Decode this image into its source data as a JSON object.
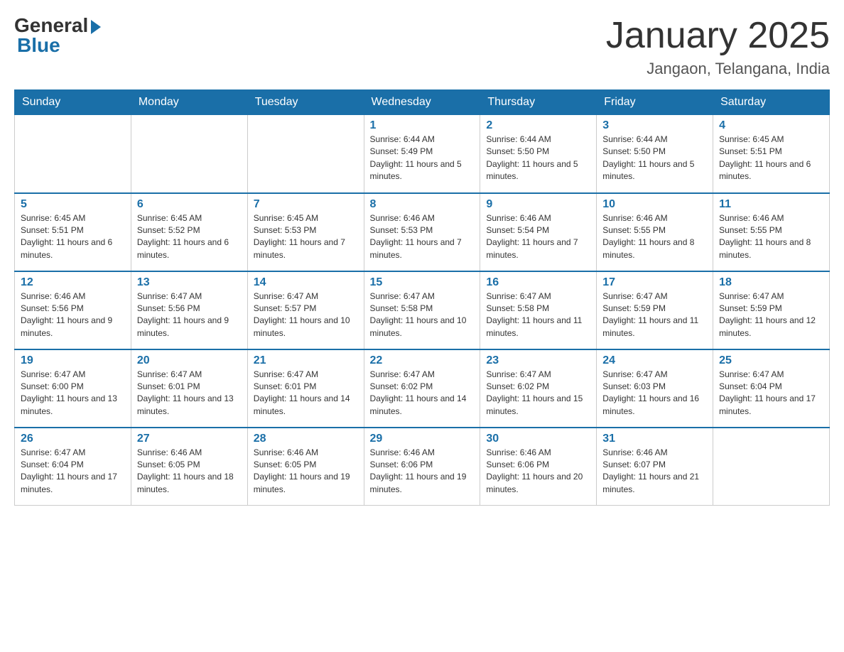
{
  "logo": {
    "general": "General",
    "blue": "Blue"
  },
  "title": "January 2025",
  "location": "Jangaon, Telangana, India",
  "days_of_week": [
    "Sunday",
    "Monday",
    "Tuesday",
    "Wednesday",
    "Thursday",
    "Friday",
    "Saturday"
  ],
  "weeks": [
    [
      {
        "day": "",
        "info": ""
      },
      {
        "day": "",
        "info": ""
      },
      {
        "day": "",
        "info": ""
      },
      {
        "day": "1",
        "info": "Sunrise: 6:44 AM\nSunset: 5:49 PM\nDaylight: 11 hours and 5 minutes."
      },
      {
        "day": "2",
        "info": "Sunrise: 6:44 AM\nSunset: 5:50 PM\nDaylight: 11 hours and 5 minutes."
      },
      {
        "day": "3",
        "info": "Sunrise: 6:44 AM\nSunset: 5:50 PM\nDaylight: 11 hours and 5 minutes."
      },
      {
        "day": "4",
        "info": "Sunrise: 6:45 AM\nSunset: 5:51 PM\nDaylight: 11 hours and 6 minutes."
      }
    ],
    [
      {
        "day": "5",
        "info": "Sunrise: 6:45 AM\nSunset: 5:51 PM\nDaylight: 11 hours and 6 minutes."
      },
      {
        "day": "6",
        "info": "Sunrise: 6:45 AM\nSunset: 5:52 PM\nDaylight: 11 hours and 6 minutes."
      },
      {
        "day": "7",
        "info": "Sunrise: 6:45 AM\nSunset: 5:53 PM\nDaylight: 11 hours and 7 minutes."
      },
      {
        "day": "8",
        "info": "Sunrise: 6:46 AM\nSunset: 5:53 PM\nDaylight: 11 hours and 7 minutes."
      },
      {
        "day": "9",
        "info": "Sunrise: 6:46 AM\nSunset: 5:54 PM\nDaylight: 11 hours and 7 minutes."
      },
      {
        "day": "10",
        "info": "Sunrise: 6:46 AM\nSunset: 5:55 PM\nDaylight: 11 hours and 8 minutes."
      },
      {
        "day": "11",
        "info": "Sunrise: 6:46 AM\nSunset: 5:55 PM\nDaylight: 11 hours and 8 minutes."
      }
    ],
    [
      {
        "day": "12",
        "info": "Sunrise: 6:46 AM\nSunset: 5:56 PM\nDaylight: 11 hours and 9 minutes."
      },
      {
        "day": "13",
        "info": "Sunrise: 6:47 AM\nSunset: 5:56 PM\nDaylight: 11 hours and 9 minutes."
      },
      {
        "day": "14",
        "info": "Sunrise: 6:47 AM\nSunset: 5:57 PM\nDaylight: 11 hours and 10 minutes."
      },
      {
        "day": "15",
        "info": "Sunrise: 6:47 AM\nSunset: 5:58 PM\nDaylight: 11 hours and 10 minutes."
      },
      {
        "day": "16",
        "info": "Sunrise: 6:47 AM\nSunset: 5:58 PM\nDaylight: 11 hours and 11 minutes."
      },
      {
        "day": "17",
        "info": "Sunrise: 6:47 AM\nSunset: 5:59 PM\nDaylight: 11 hours and 11 minutes."
      },
      {
        "day": "18",
        "info": "Sunrise: 6:47 AM\nSunset: 5:59 PM\nDaylight: 11 hours and 12 minutes."
      }
    ],
    [
      {
        "day": "19",
        "info": "Sunrise: 6:47 AM\nSunset: 6:00 PM\nDaylight: 11 hours and 13 minutes."
      },
      {
        "day": "20",
        "info": "Sunrise: 6:47 AM\nSunset: 6:01 PM\nDaylight: 11 hours and 13 minutes."
      },
      {
        "day": "21",
        "info": "Sunrise: 6:47 AM\nSunset: 6:01 PM\nDaylight: 11 hours and 14 minutes."
      },
      {
        "day": "22",
        "info": "Sunrise: 6:47 AM\nSunset: 6:02 PM\nDaylight: 11 hours and 14 minutes."
      },
      {
        "day": "23",
        "info": "Sunrise: 6:47 AM\nSunset: 6:02 PM\nDaylight: 11 hours and 15 minutes."
      },
      {
        "day": "24",
        "info": "Sunrise: 6:47 AM\nSunset: 6:03 PM\nDaylight: 11 hours and 16 minutes."
      },
      {
        "day": "25",
        "info": "Sunrise: 6:47 AM\nSunset: 6:04 PM\nDaylight: 11 hours and 17 minutes."
      }
    ],
    [
      {
        "day": "26",
        "info": "Sunrise: 6:47 AM\nSunset: 6:04 PM\nDaylight: 11 hours and 17 minutes."
      },
      {
        "day": "27",
        "info": "Sunrise: 6:46 AM\nSunset: 6:05 PM\nDaylight: 11 hours and 18 minutes."
      },
      {
        "day": "28",
        "info": "Sunrise: 6:46 AM\nSunset: 6:05 PM\nDaylight: 11 hours and 19 minutes."
      },
      {
        "day": "29",
        "info": "Sunrise: 6:46 AM\nSunset: 6:06 PM\nDaylight: 11 hours and 19 minutes."
      },
      {
        "day": "30",
        "info": "Sunrise: 6:46 AM\nSunset: 6:06 PM\nDaylight: 11 hours and 20 minutes."
      },
      {
        "day": "31",
        "info": "Sunrise: 6:46 AM\nSunset: 6:07 PM\nDaylight: 11 hours and 21 minutes."
      },
      {
        "day": "",
        "info": ""
      }
    ]
  ]
}
